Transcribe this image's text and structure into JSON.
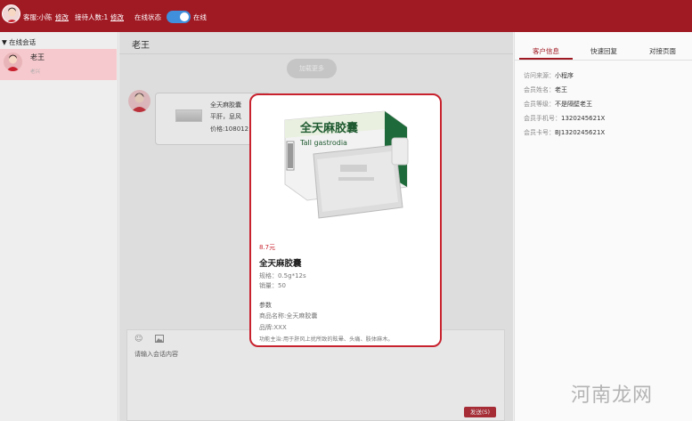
{
  "topbar": {
    "agent_label": "客服:小陈",
    "edit1": "修改",
    "reception_label": "接待人数:1",
    "edit2": "修改",
    "status_label": "在线状态",
    "status_value": "在线",
    "toggle_on": true
  },
  "sidebar": {
    "title": "▼ 在线会话",
    "sessions": [
      {
        "name": "老王",
        "sub": "老兴"
      }
    ]
  },
  "chat": {
    "title": "老王",
    "load_more": "加载更多",
    "product_card": {
      "line1": "全天麻胶囊",
      "line2": "平肝，息风",
      "line3": "价格:108012"
    },
    "input_placeholder": "请输入会话内容",
    "send": "发送(S)"
  },
  "right_panel": {
    "tabs": [
      "客户信息",
      "快速回复",
      "对接页面"
    ],
    "info": [
      {
        "label": "访问来源：",
        "value": "小程序"
      },
      {
        "label": "会员姓名：",
        "value": "老王"
      },
      {
        "label": "会员等级：",
        "value": "不是隔壁老王"
      },
      {
        "label": "会员手机号：",
        "value": "1320245621X"
      },
      {
        "label": "会员卡号：",
        "value": "BJ1320245621X"
      }
    ]
  },
  "modal": {
    "box_title": "全天麻胶囊",
    "box_sub": "Tall gastrodia",
    "price": "8.7元",
    "name": "全天麻胶囊",
    "spec": "规格：0.5g*12s",
    "sales": "销量：50",
    "params_title": "参数",
    "generic_name": "商品名称:全天麻胶囊",
    "brand": "品牌:XXX",
    "indication": "功能主治:用于肝风上扰所致的眩晕、头痛、肢体麻木。"
  },
  "watermark": "河南龙网",
  "colors": {
    "brand": "#a01a24",
    "toggle": "#3f8fdc",
    "session_bg": "#f5c9cd"
  }
}
